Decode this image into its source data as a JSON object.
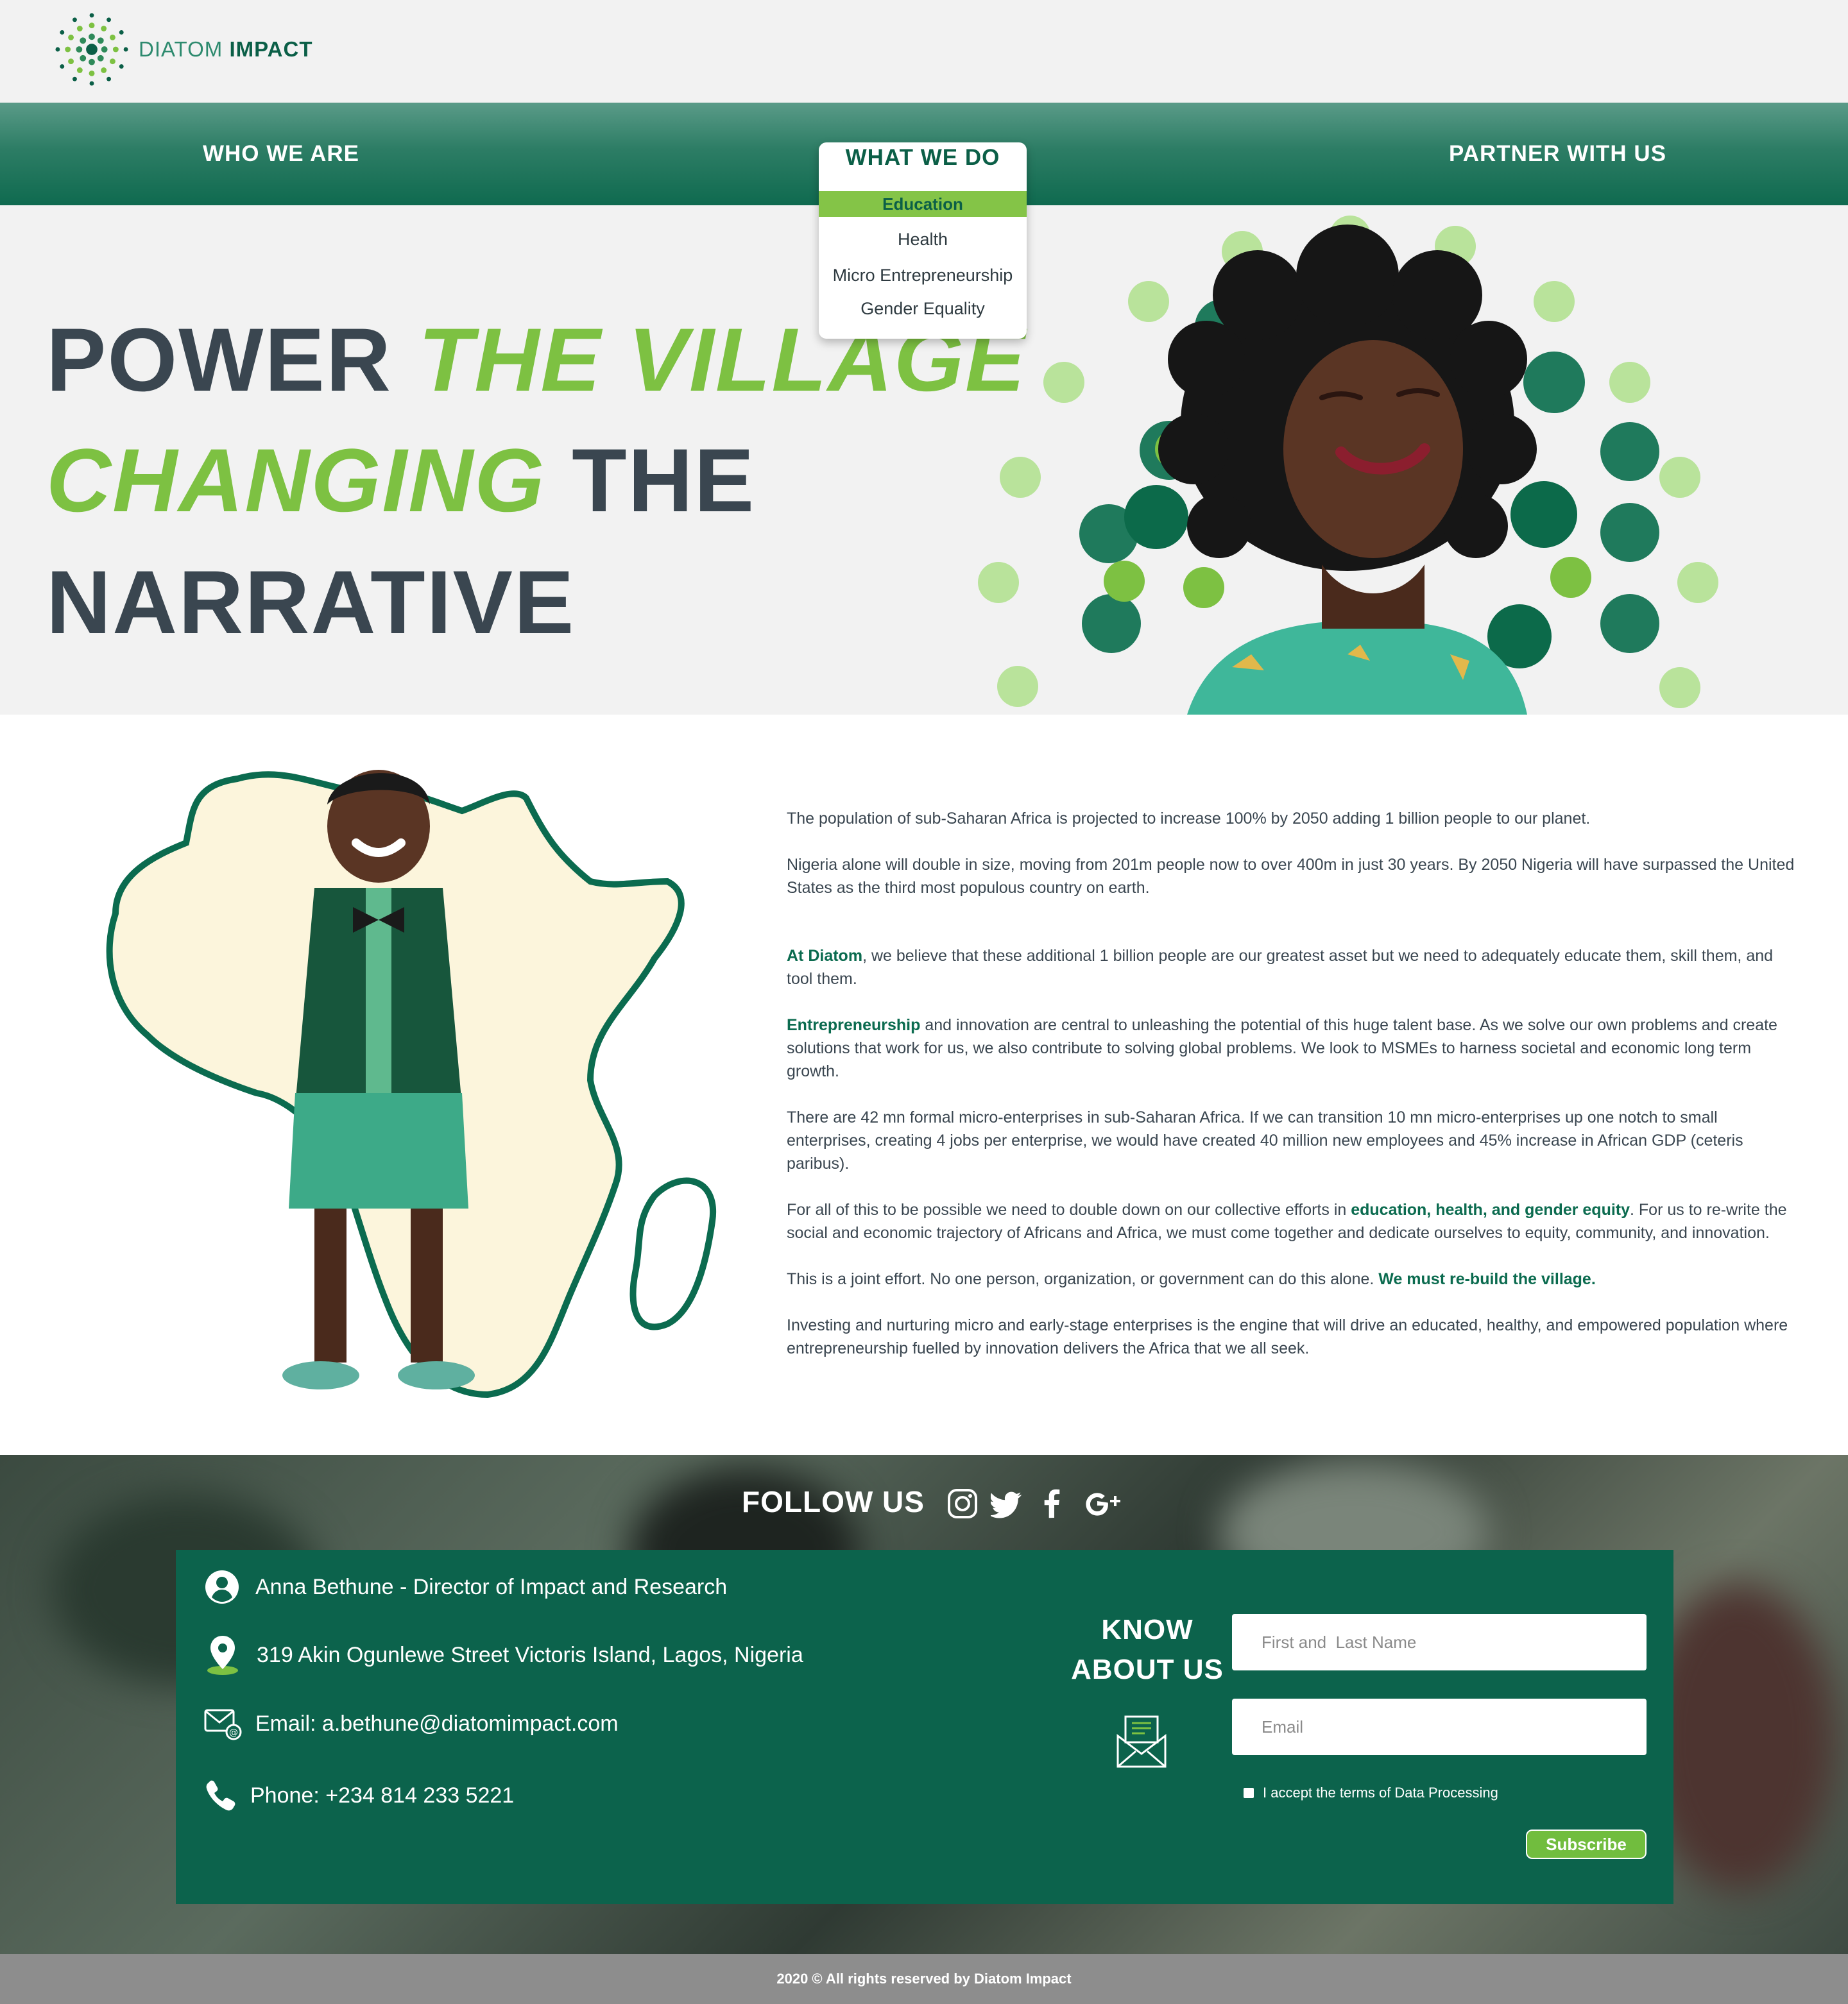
{
  "brand": {
    "name_light": "DIATOM",
    "name_bold": "IMPACT",
    "primary_color": "#0b5f47",
    "accent_color": "#7dc142"
  },
  "nav": {
    "who_we_are": "WHO WE ARE",
    "what_we_do": "WHAT WE DO",
    "partner_with_us": "PARTNER WITH US",
    "dropdown": [
      "Education",
      "Health",
      "Micro Entrepreneurship",
      "Gender Equality"
    ],
    "dropdown_active": "Education"
  },
  "hero": {
    "line1_dark": "POWER ",
    "line1_green": "THE VILLAGE",
    "line2_green": "CHANGING",
    "line2_dark": " THE",
    "line3_dark": "NARRATIVE"
  },
  "content": {
    "p1": "The population of sub-Saharan Africa is projected to increase 100% by 2050 adding 1 billion people to our planet.",
    "p2": "Nigeria alone will double in size, moving from 201m people now to over 400m in just 30 years. By 2050 Nigeria will have surpassed the United States as the third most populous country on earth.",
    "p3_hl": "At Diatom",
    "p3": ", we believe that these additional 1 billion people are our greatest asset but we need to adequately educate them, skill them, and tool them.",
    "p4_hl": "Entrepreneurship",
    "p4": " and innovation are central to unleashing the potential of this huge talent base. As we solve our own problems and create solutions that work for us, we also contribute to solving global problems. We look to MSMEs to harness societal and economic long term growth.",
    "p5": "There are 42 mn formal micro-enterprises in sub-Saharan Africa. If we can transition 10 mn micro-enterprises up one notch to small enterprises, creating 4 jobs per enterprise, we would have created 40 million new employees and 45% increase in African GDP (ceteris paribus).",
    "p6_a": "For all of this to be possible we need to double down on our collective efforts in ",
    "p6_hl": "education, health, and gender equity",
    "p6_b": ". For us to re-write the social and economic trajectory of Africans and Africa, we must come together and dedicate ourselves to equity, community, and innovation.",
    "p7_a": "This is a joint effort. No one person, organization, or government can do this alone. ",
    "p7_hl": "We must re-build the village.",
    "p8": "Investing and nurturing micro and early-stage enterprises is the engine that will drive an educated, healthy, and empowered population where entrepreneurship fuelled by innovation delivers the Africa that we all seek."
  },
  "footer": {
    "follow_us": "FOLLOW US",
    "social_icons": [
      "instagram-icon",
      "twitter-icon",
      "facebook-icon",
      "google-plus-icon"
    ],
    "contact_name": "Anna Bethune - Director of Impact and Research",
    "address": "319 Akin Ogunlewe Street Victoris Island, Lagos, Nigeria",
    "email": "Email: a.bethune@diatomimpact.com",
    "phone": "Phone: +234 814 233 5221",
    "know_line1": "KNOW",
    "know_line2": "ABOUT US",
    "name_placeholder": "First and  Last Name",
    "email_placeholder": "Email",
    "terms": "I accept the terms of Data Processing",
    "subscribe": "Subscribe",
    "copyright": "2020 © All rights reserved by Diatom Impact"
  }
}
